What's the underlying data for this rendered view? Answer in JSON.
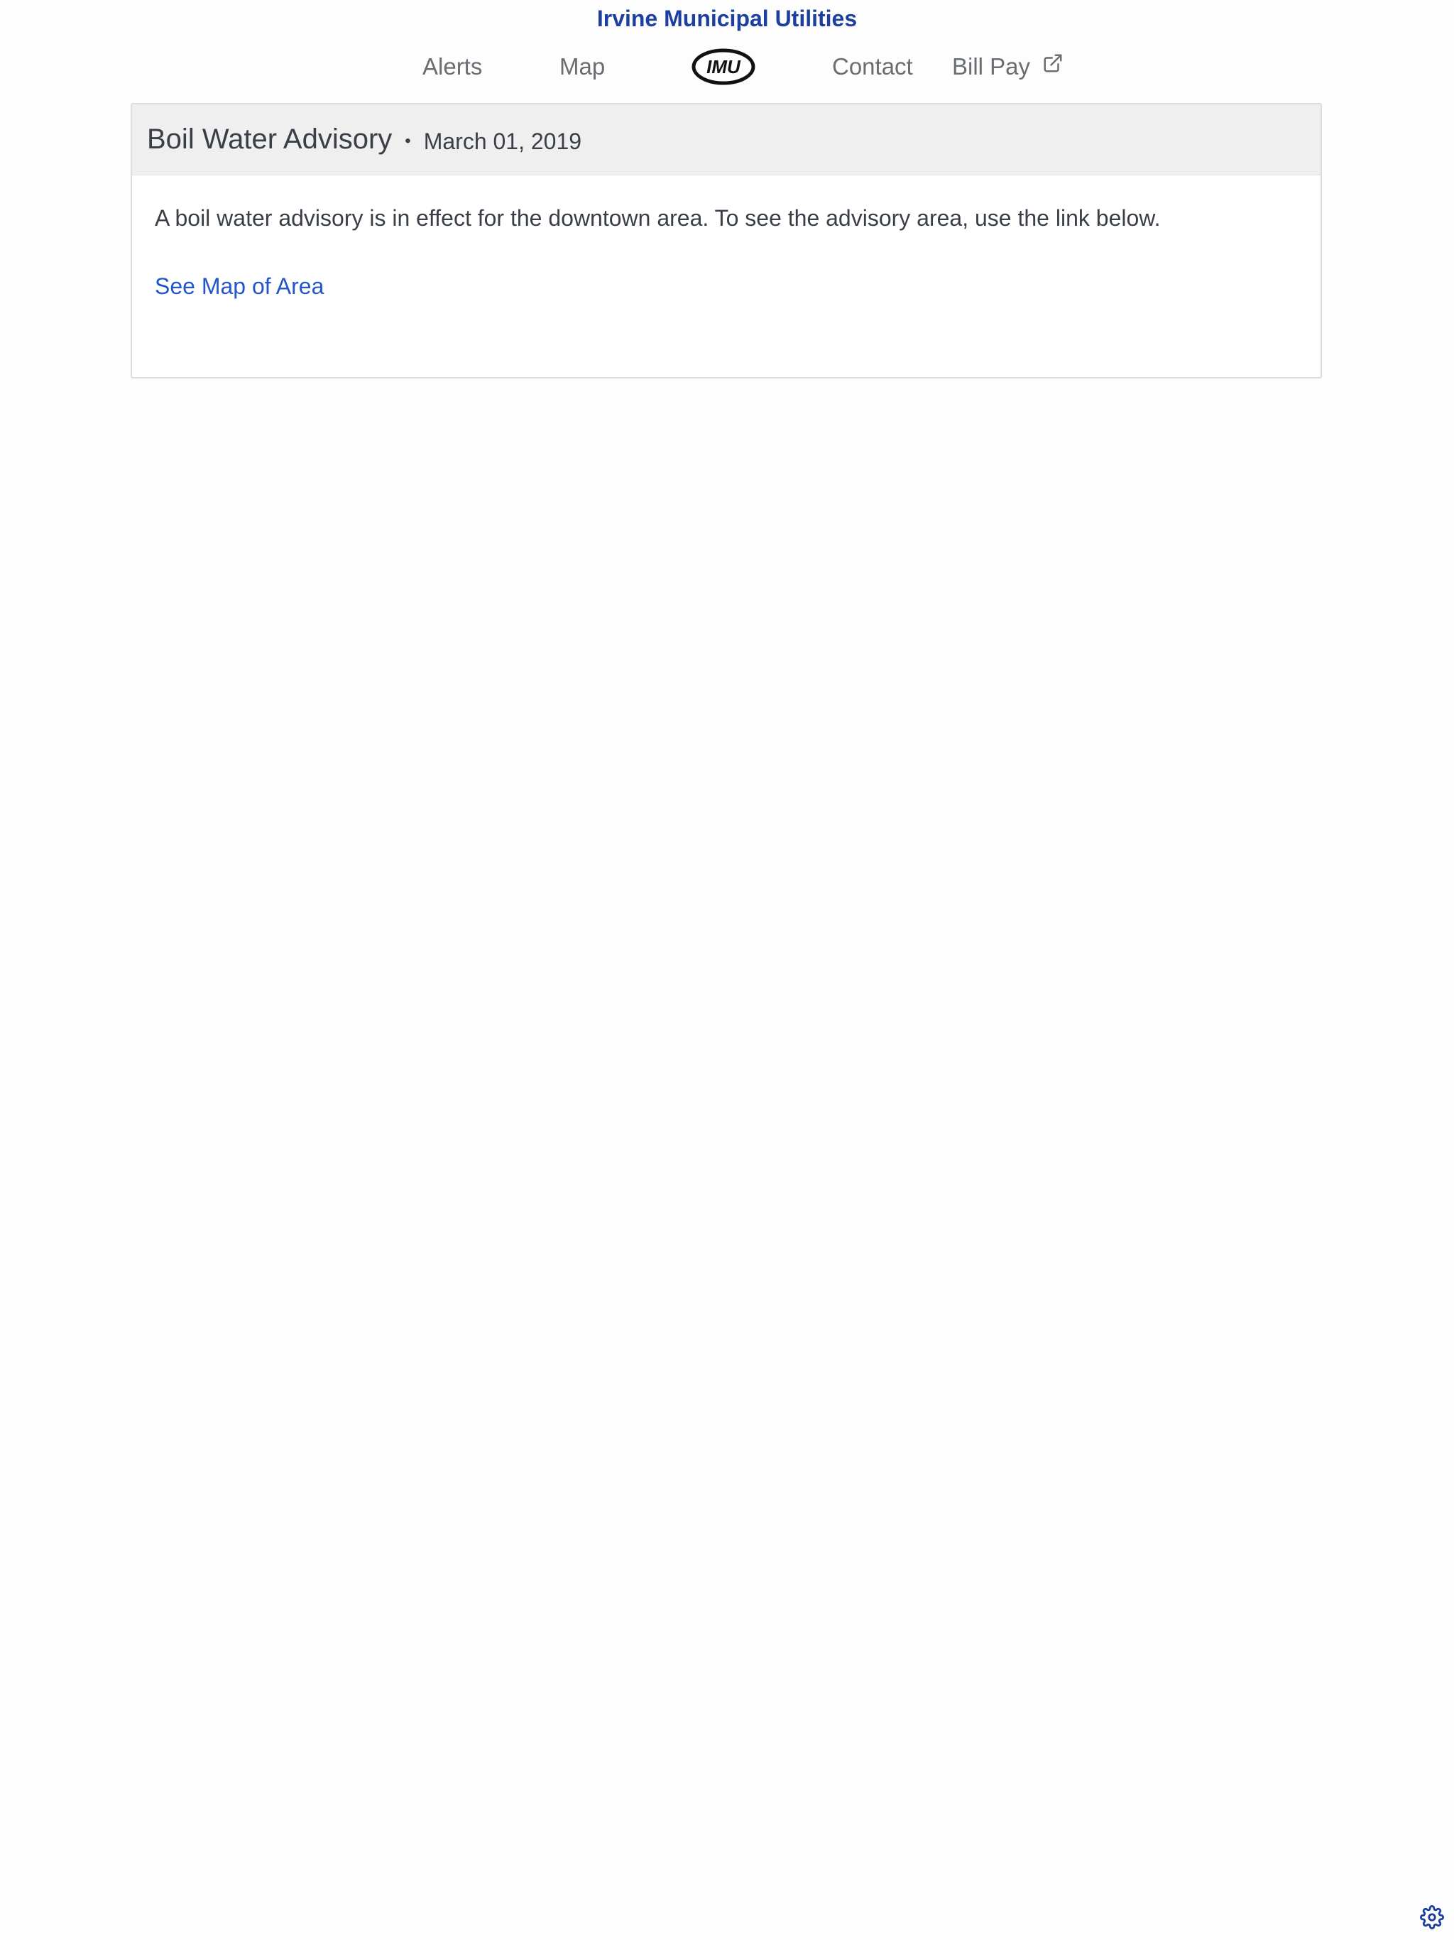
{
  "header": {
    "site_title": "Irvine Municipal Utilities"
  },
  "nav": {
    "alerts": "Alerts",
    "map": "Map",
    "logo_text": "IMU",
    "contact": "Contact",
    "bill_pay": "Bill Pay",
    "bill_pay_icon": "external-link-icon"
  },
  "alert": {
    "title": "Boil Water Advisory",
    "separator": "•",
    "date": "March 01, 2019",
    "body": "A boil water advisory is in effect for the downtown area. To see the advisory area, use the link below.",
    "link_label": "See Map of Area"
  },
  "footer": {
    "settings_icon": "gear-icon"
  },
  "colors": {
    "brand_blue": "#1d3fa0",
    "link_blue": "#2456c9",
    "nav_gray": "#6a6d72",
    "header_bg": "#efefef"
  }
}
